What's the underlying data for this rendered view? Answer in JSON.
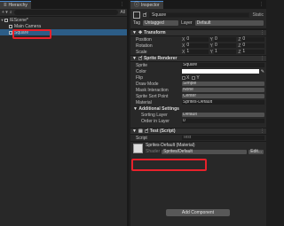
{
  "hierarchy": {
    "tab_label": "Hierarchy",
    "add_label": "+ ▾",
    "search_label": "All",
    "scene_name": "IEScene*",
    "items": [
      {
        "label": "Main Camera"
      },
      {
        "label": "Square"
      }
    ]
  },
  "inspector": {
    "tab_label": "Inspector",
    "object_name": "Square",
    "static_label": "Static",
    "tag_label": "Tag",
    "tag_value": "Untagged",
    "layer_label": "Layer",
    "layer_value": "Default",
    "transform": {
      "title": "Transform",
      "rows": [
        {
          "label": "Position",
          "x": "0",
          "y": "0",
          "z": "0"
        },
        {
          "label": "Rotation",
          "x": "0",
          "y": "0",
          "z": "0"
        },
        {
          "label": "Scale",
          "x": "1",
          "y": "1",
          "z": "1"
        }
      ]
    },
    "sprite_renderer": {
      "title": "Sprite Renderer",
      "sprite_label": "Sprite",
      "sprite_value": "Square",
      "color_label": "Color",
      "flip_label": "Flip",
      "flip_x": "X",
      "flip_y": "Y",
      "draw_mode_label": "Draw Mode",
      "draw_mode_value": "Simple",
      "mask_label": "Mask Interaction",
      "mask_value": "None",
      "sort_point_label": "Sprite Sort Point",
      "sort_point_value": "Center",
      "material_label": "Material",
      "material_value": "Sprites-Default",
      "additional_label": "Additional Settings",
      "sorting_layer_label": "Sorting Layer",
      "sorting_layer_value": "Default",
      "order_label": "Order in Layer",
      "order_value": "0"
    },
    "test_script": {
      "title": "Test (Script)",
      "script_label": "Script",
      "script_value": "Test"
    },
    "material": {
      "title": "Sprites-Default (Material)",
      "shader_label": "Shader",
      "shader_value": "Sprites/Default",
      "edit_label": "Edit..."
    },
    "add_component_label": "Add Component"
  }
}
